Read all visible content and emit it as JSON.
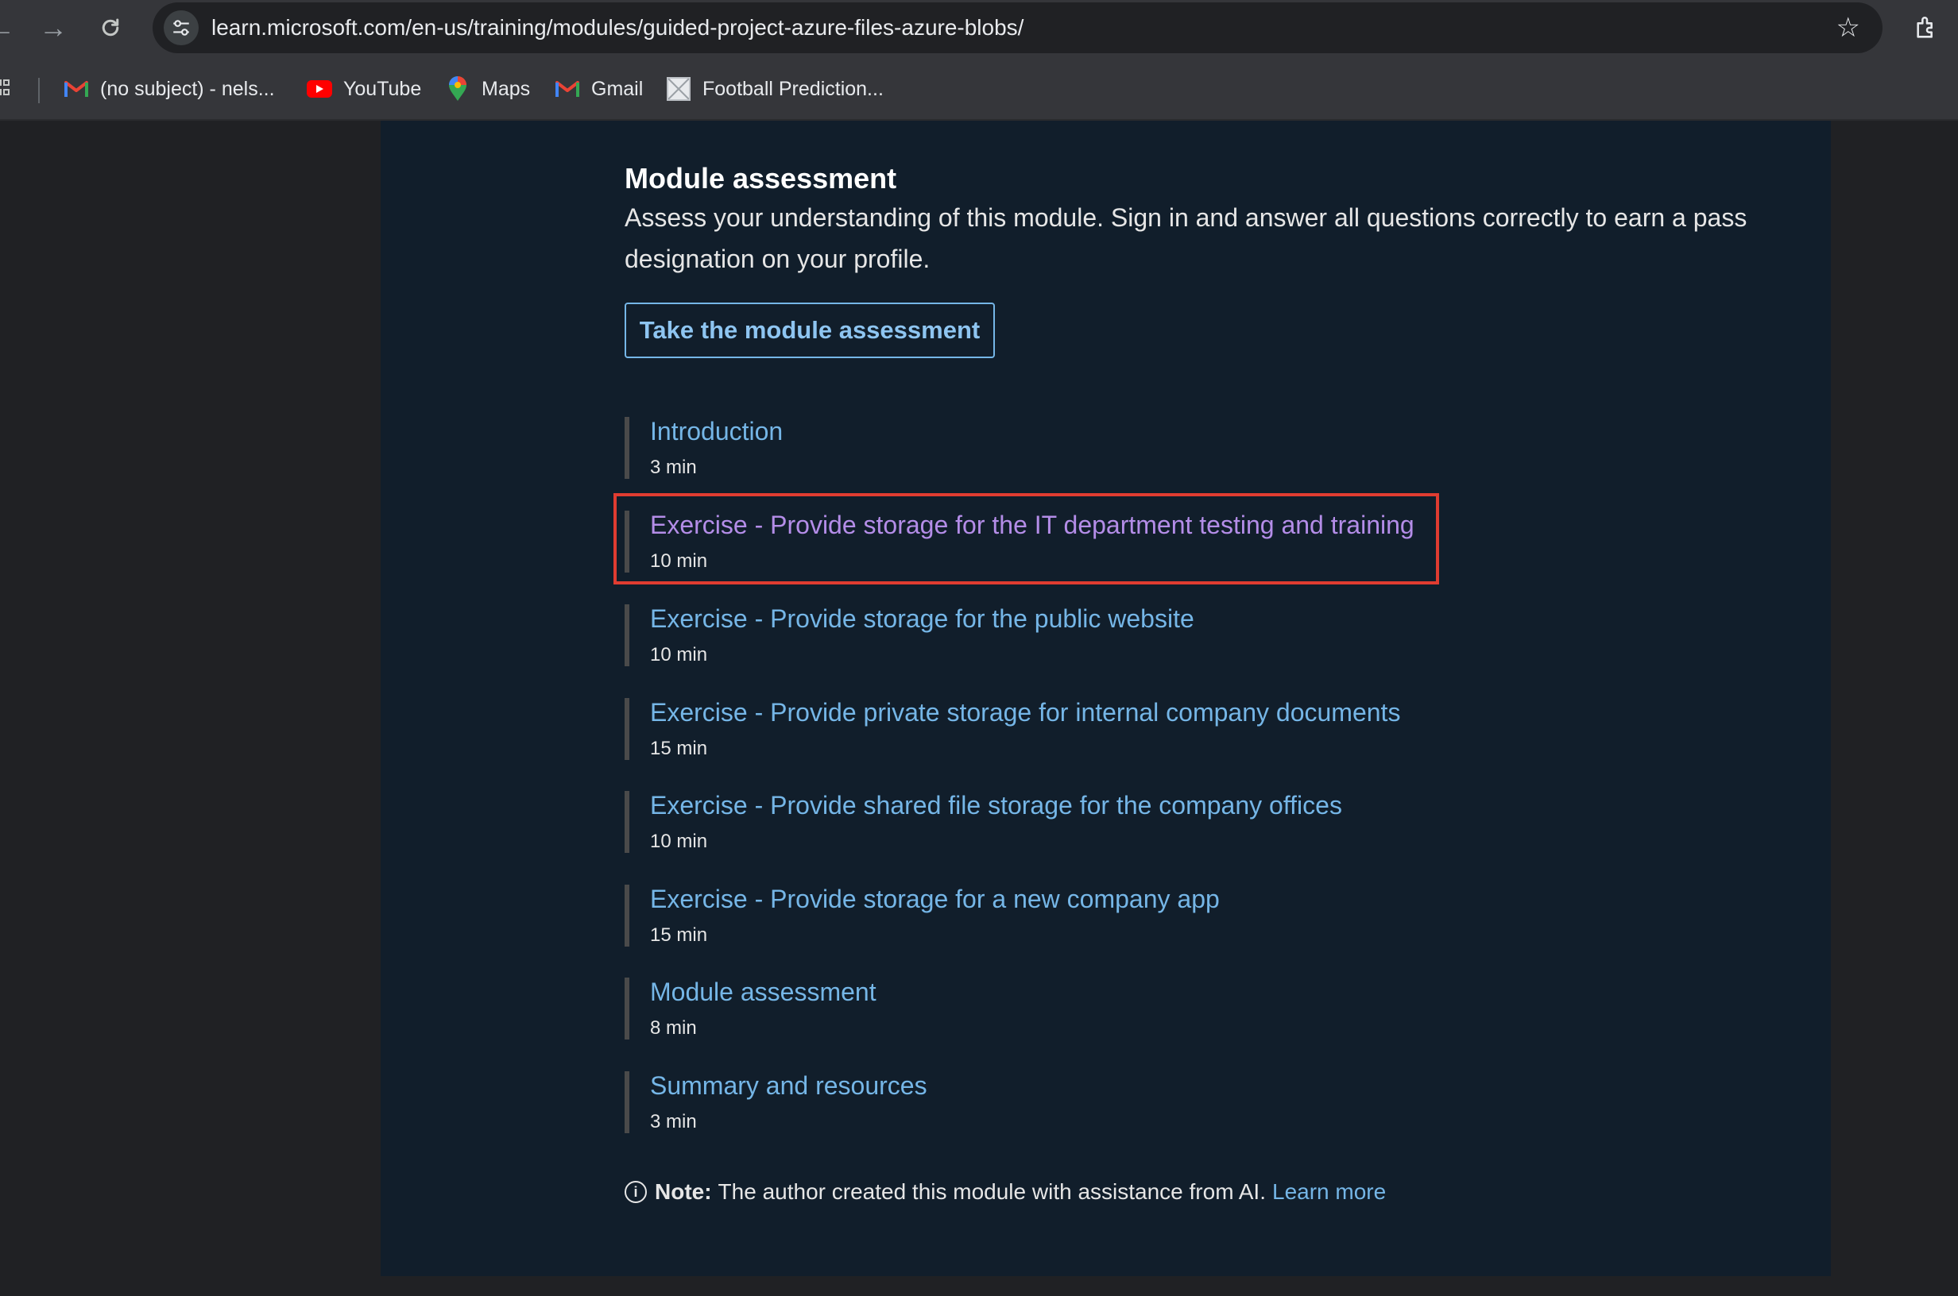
{
  "browser": {
    "url": "learn.microsoft.com/en-us/training/modules/guided-project-azure-files-azure-blobs/",
    "bookmarks": [
      {
        "label": "(no subject) - nels...",
        "icon": "gmail-icon"
      },
      {
        "label": "YouTube",
        "icon": "youtube-icon"
      },
      {
        "label": "Maps",
        "icon": "maps-icon"
      },
      {
        "label": "Gmail",
        "icon": "gmail-icon"
      },
      {
        "label": "Football Prediction...",
        "icon": "image-icon"
      }
    ]
  },
  "assessment": {
    "title": "Module assessment",
    "description": "Assess your understanding of this module. Sign in and answer all questions correctly to earn a pass designation on your profile.",
    "button_label": "Take the module assessment"
  },
  "units": [
    {
      "title": "Introduction",
      "duration": "3 min"
    },
    {
      "title": "Exercise - Provide storage for the IT department testing and training",
      "duration": "10 min",
      "visited": true,
      "highlighted": true
    },
    {
      "title": "Exercise - Provide storage for the public website",
      "duration": "10 min"
    },
    {
      "title": "Exercise - Provide private storage for internal company documents",
      "duration": "15 min"
    },
    {
      "title": "Exercise - Provide shared file storage for the company offices",
      "duration": "10 min"
    },
    {
      "title": "Exercise - Provide storage for a new company app",
      "duration": "15 min"
    },
    {
      "title": "Module assessment",
      "duration": "8 min"
    },
    {
      "title": "Summary and resources",
      "duration": "3 min"
    }
  ],
  "note": {
    "label": "Note:",
    "text": "The author created this module with assistance from AI.",
    "link": "Learn more"
  },
  "colors": {
    "link": "#75b6e7",
    "visited_link": "#b48de8",
    "highlight_border": "#e03c31",
    "page_background": "#111e2b"
  }
}
